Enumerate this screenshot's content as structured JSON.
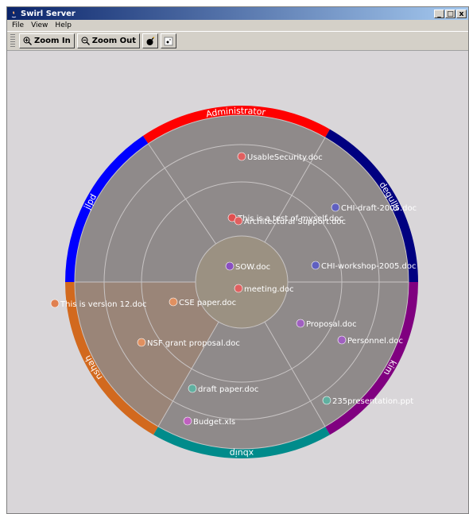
{
  "window": {
    "title": "Swirl Server",
    "buttons": {
      "minimize": "_",
      "maximize": "□",
      "close": "x"
    }
  },
  "menu": {
    "file": "File",
    "view": "View",
    "help": "Help"
  },
  "toolbar": {
    "zoom_in": "Zoom In",
    "zoom_out": "Zoom Out"
  },
  "users": [
    "Administrator",
    "degulla",
    "kim",
    "xbuip",
    "nshah",
    "jlpd"
  ],
  "user_colors": [
    "#ff0000",
    "#000080",
    "#800080",
    "#008b8b",
    "#d2691e",
    "#0000ff"
  ],
  "documents": [
    {
      "name": "UsableSecurity.doc",
      "color": "#e06060"
    },
    {
      "name": "This is a test of myself.doc",
      "color": "#e05050"
    },
    {
      "name": "Architectural Support.doc",
      "color": "#e06060"
    },
    {
      "name": "CHI-draft-2005.doc",
      "color": "#6060c0"
    },
    {
      "name": "CHI-workshop-2005.doc",
      "color": "#6060c0"
    },
    {
      "name": "SOW.doc",
      "color": "#8a50c0"
    },
    {
      "name": "meeting.doc",
      "color": "#e06060"
    },
    {
      "name": "CSE paper.doc",
      "color": "#e09060"
    },
    {
      "name": "This is version 12.doc",
      "color": "#e08050"
    },
    {
      "name": "NSF grant proposal.doc",
      "color": "#e09060"
    },
    {
      "name": "Proposal.doc",
      "color": "#a060c0"
    },
    {
      "name": "Personnel.doc",
      "color": "#a060c0"
    },
    {
      "name": "draft paper.doc",
      "color": "#60b0a0"
    },
    {
      "name": "235presentation.ppt",
      "color": "#60b0a0"
    },
    {
      "name": "Budget.xls",
      "color": "#c060c0"
    }
  ]
}
